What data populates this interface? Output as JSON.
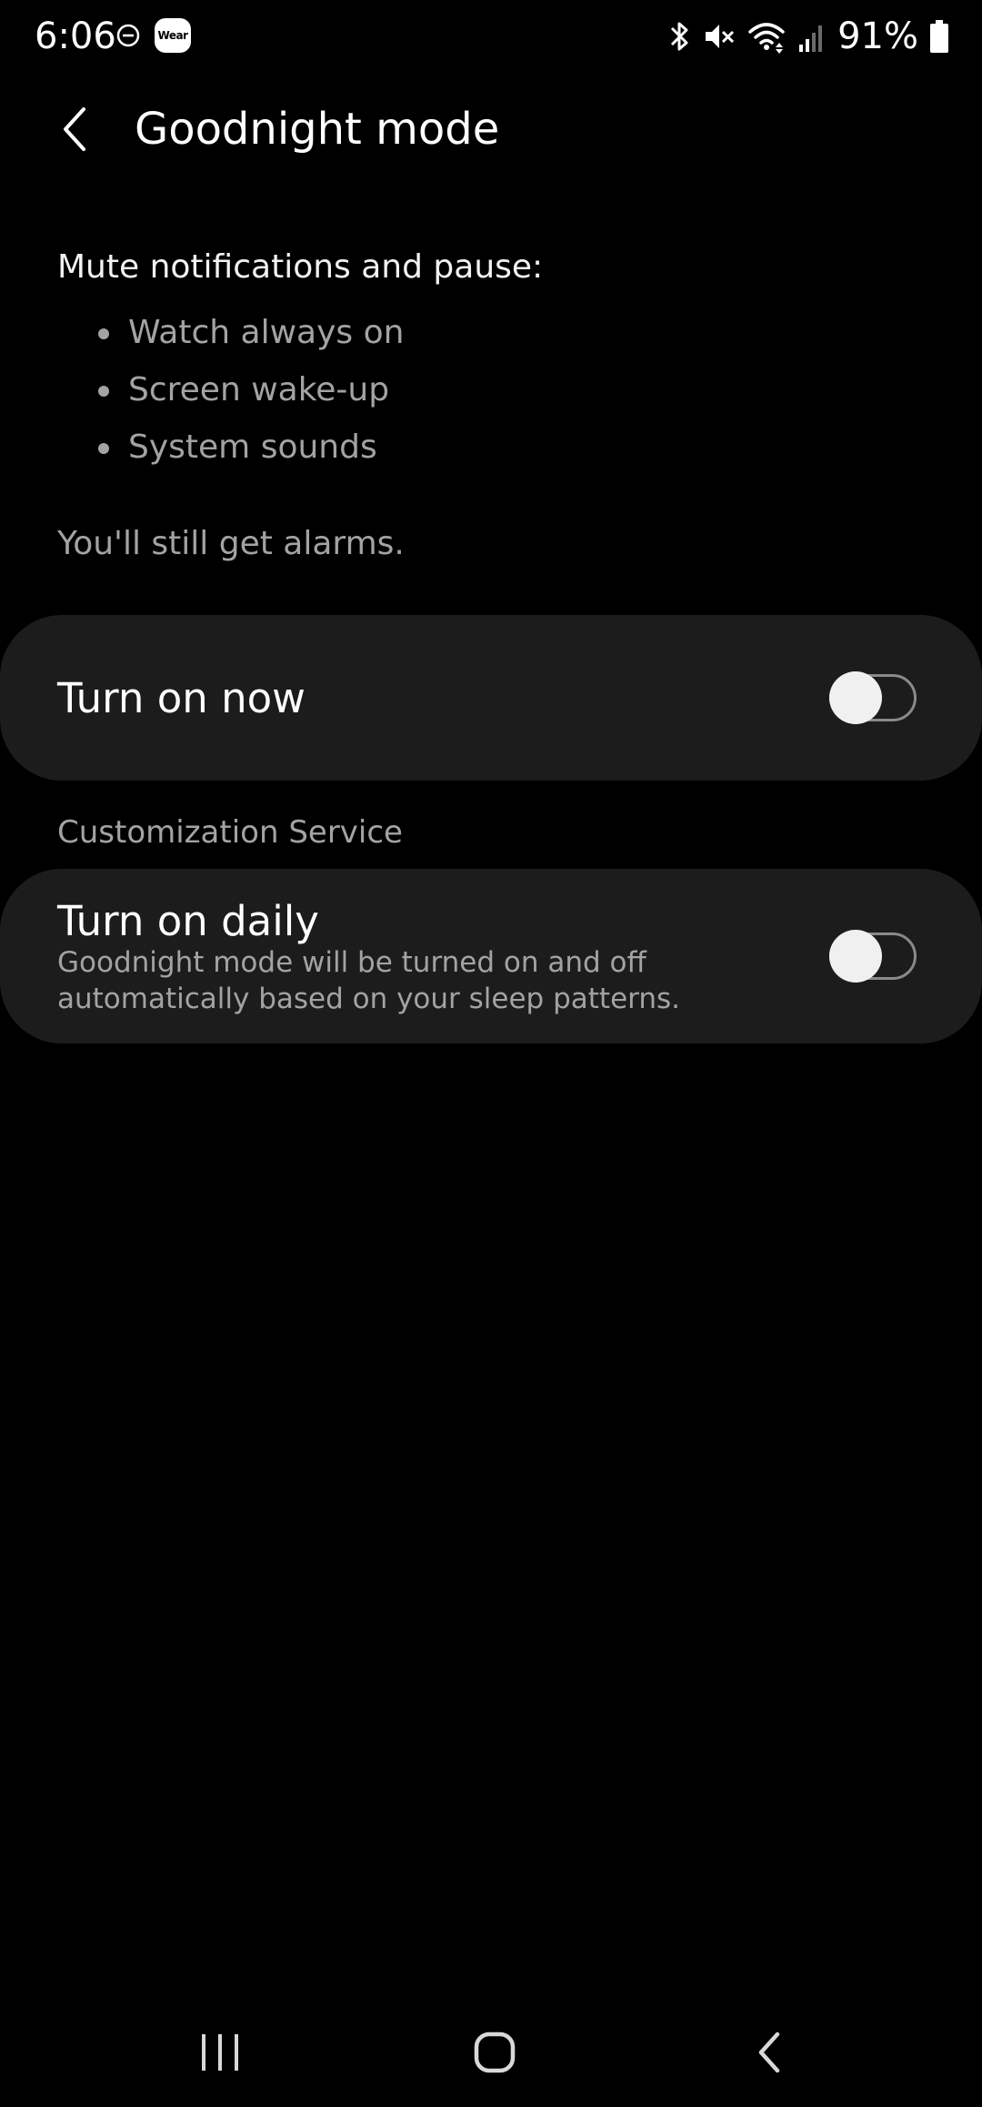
{
  "status_bar": {
    "time": "6:06",
    "battery": "91%",
    "wear_label": "Wear",
    "icons": [
      "do-not-disturb-icon",
      "wear-app-icon",
      "bluetooth-icon",
      "mute-icon",
      "wifi-icon",
      "signal-icon",
      "battery-icon"
    ]
  },
  "header": {
    "title": "Goodnight mode"
  },
  "description": {
    "heading": "Mute notifications and pause:",
    "items": [
      "Watch always on",
      "Screen wake-up",
      "System sounds"
    ],
    "note": "You'll still get alarms."
  },
  "turn_on_now": {
    "label": "Turn on now",
    "enabled": false
  },
  "section": {
    "label": "Customization Service"
  },
  "turn_on_daily": {
    "label": "Turn on daily",
    "description": "Goodnight mode will be turned on and off automatically based on your sleep patterns.",
    "enabled": false
  },
  "nav_bar": {
    "icons": [
      "recent-apps-icon",
      "home-icon",
      "back-icon"
    ]
  }
}
